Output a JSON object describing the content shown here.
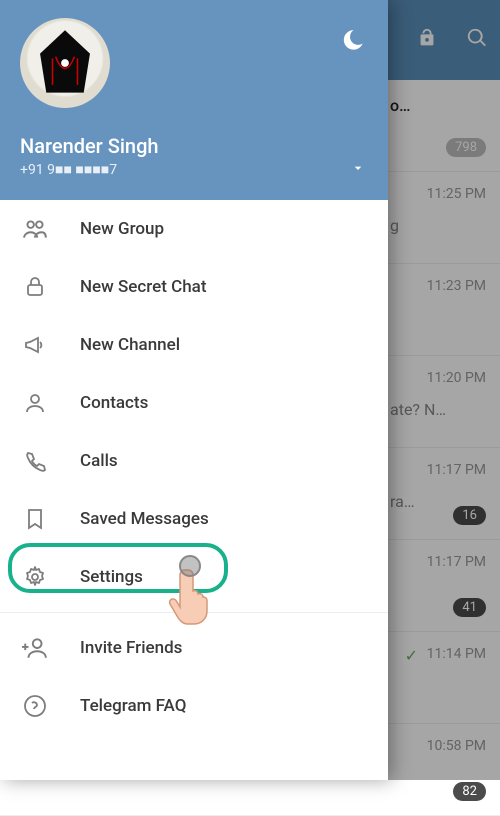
{
  "header": {
    "name": "Narender Singh",
    "phone": "+91 9■■ ■■■■7"
  },
  "menu": {
    "new_group": "New Group",
    "new_secret_chat": "New Secret Chat",
    "new_channel": "New Channel",
    "contacts": "Contacts",
    "calls": "Calls",
    "saved_messages": "Saved Messages",
    "settings": "Settings",
    "invite_friends": "Invite Friends",
    "telegram_faq": "Telegram FAQ"
  },
  "chats": [
    {
      "frag_title": "o…",
      "time": "",
      "badge": "798"
    },
    {
      "frag_title": "",
      "frag_sub": "g",
      "time": "11:25 PM",
      "badge": ""
    },
    {
      "frag_title": "",
      "time": "11:23 PM",
      "badge": ""
    },
    {
      "frag_title": "",
      "frag_sub": "ate? N…",
      "time": "11:20 PM",
      "badge": ""
    },
    {
      "frag_title": "",
      "frag_sub": "ra…",
      "time": "11:17 PM",
      "badge": "16"
    },
    {
      "frag_title": "",
      "time": "11:17 PM",
      "badge": "41"
    },
    {
      "frag_title": "",
      "time": "11:14 PM",
      "badge": "",
      "tick": true
    },
    {
      "frag_title": "",
      "time": "10:58 PM",
      "badge": "82"
    }
  ]
}
